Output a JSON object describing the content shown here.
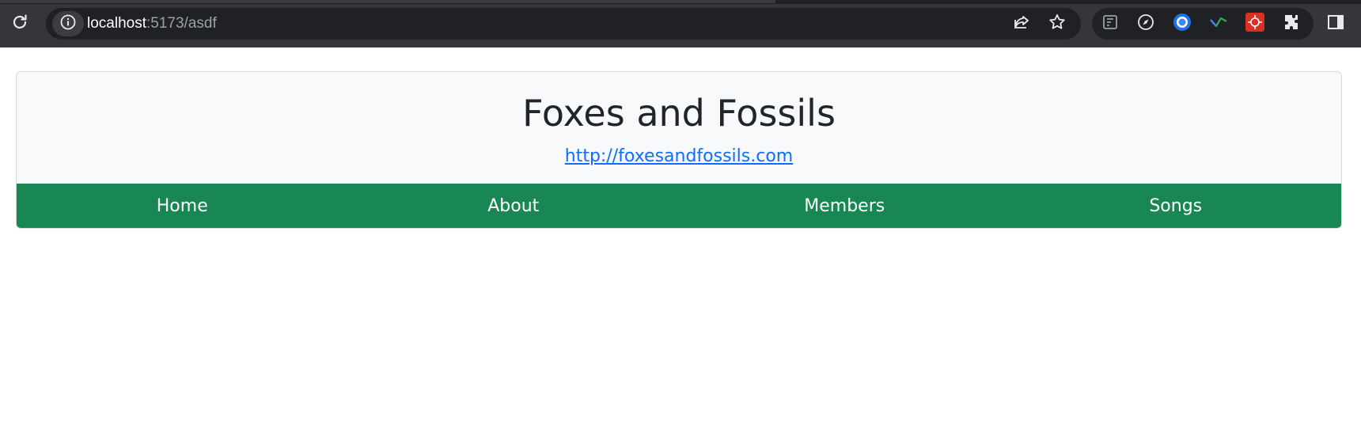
{
  "browser": {
    "url_host": "localhost",
    "url_rest": ":5173/asdf",
    "colors": {
      "toolbar": "#35363a",
      "omnibox": "#202124",
      "url_text": "#ffffff",
      "url_muted": "#9aa0a6"
    },
    "icons": {
      "reload": "reload-icon",
      "site_info": "info-icon",
      "share": "share-icon",
      "bookmark": "star-icon",
      "extensions": [
        "extension-icon-1",
        "compass-icon",
        "blue-circle-icon",
        "green-check-icon",
        "red-extension-icon",
        "puzzle-icon"
      ],
      "side_panel": "side-panel-icon"
    }
  },
  "site": {
    "title": "Foxes and Fossils",
    "link": "http://foxesandfossils.com",
    "nav": {
      "items": [
        {
          "label": "Home"
        },
        {
          "label": "About"
        },
        {
          "label": "Members"
        },
        {
          "label": "Songs"
        }
      ]
    },
    "colors": {
      "card_bg": "#f8f9fa",
      "nav_bg": "#198754",
      "nav_text": "#ffffff",
      "link": "#0d6efd",
      "title": "#212529"
    }
  }
}
